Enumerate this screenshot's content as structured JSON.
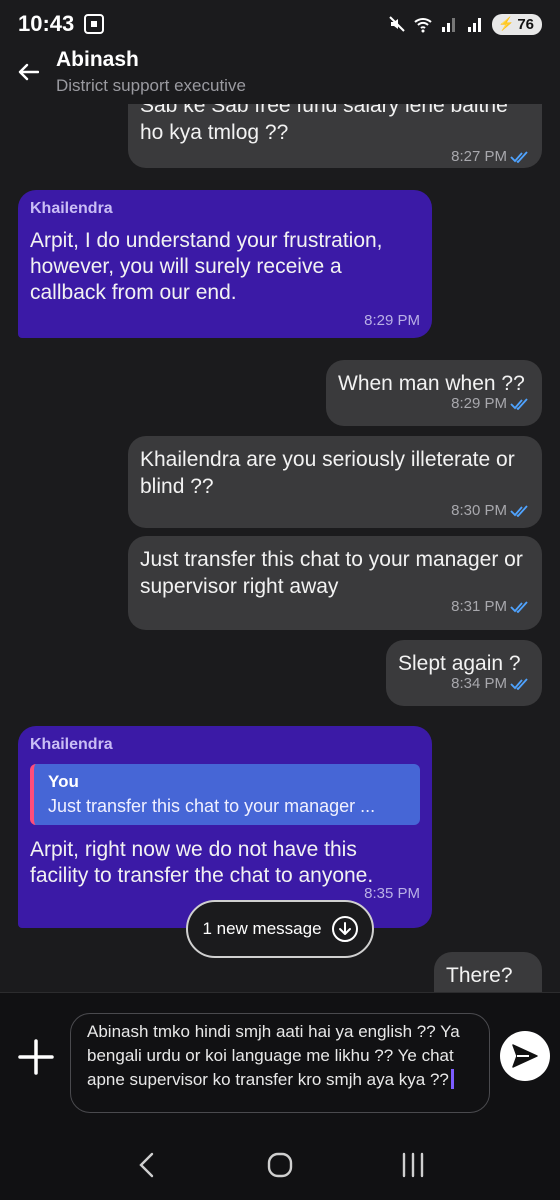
{
  "status_bar": {
    "time": "10:43",
    "battery": "76",
    "icons": [
      "screenshot-icon",
      "mute-icon",
      "wifi-icon",
      "signal-icon",
      "signal-icon",
      "battery-icon"
    ]
  },
  "header": {
    "name": "Abinash",
    "subtitle": "District support executive"
  },
  "messages": [
    {
      "dir": "out",
      "text": "Sab ke Sab free fund salary lene baithe ho kya tmlog ??",
      "time": "8:27 PM",
      "read": true
    },
    {
      "dir": "in",
      "sender": "Khailendra",
      "text": "Arpit, I do understand your frustration, however, you will surely receive a callback from our end.",
      "time": "8:29 PM"
    },
    {
      "dir": "out",
      "text": "When man when ??",
      "time": "8:29 PM",
      "read": true
    },
    {
      "dir": "out",
      "text": "Khailendra are you seriously illeterate or blind ??",
      "time": "8:30 PM",
      "read": true
    },
    {
      "dir": "out",
      "text": "Just transfer this chat to your manager or supervisor right away",
      "time": "8:31 PM",
      "read": true
    },
    {
      "dir": "out",
      "text": "Slept again ?",
      "time": "8:34 PM",
      "read": true
    },
    {
      "dir": "in",
      "sender": "Khailendra",
      "quote_author": "You",
      "quote_text": "Just transfer this chat to your manager ...",
      "text": "Arpit, right now we do not have this facility to transfer the chat to anyone.",
      "time": "8:35 PM"
    },
    {
      "dir": "out",
      "text": "There?",
      "time": ""
    }
  ],
  "new_message_pill": "1 new message",
  "composer": {
    "text": "Abinash tmko hindi smjh aati hai ya english ?? Ya bengali urdu or koi language me likhu ?? Ye chat apne supervisor ko transfer kro smjh aya kya ??"
  },
  "colors": {
    "incoming_bubble": "#3b1aa6",
    "outgoing_bubble": "#3a3a3c",
    "quote_bg": "#4666d6",
    "quote_bar": "#ff4d7a",
    "read_check": "#4fa3ff"
  }
}
